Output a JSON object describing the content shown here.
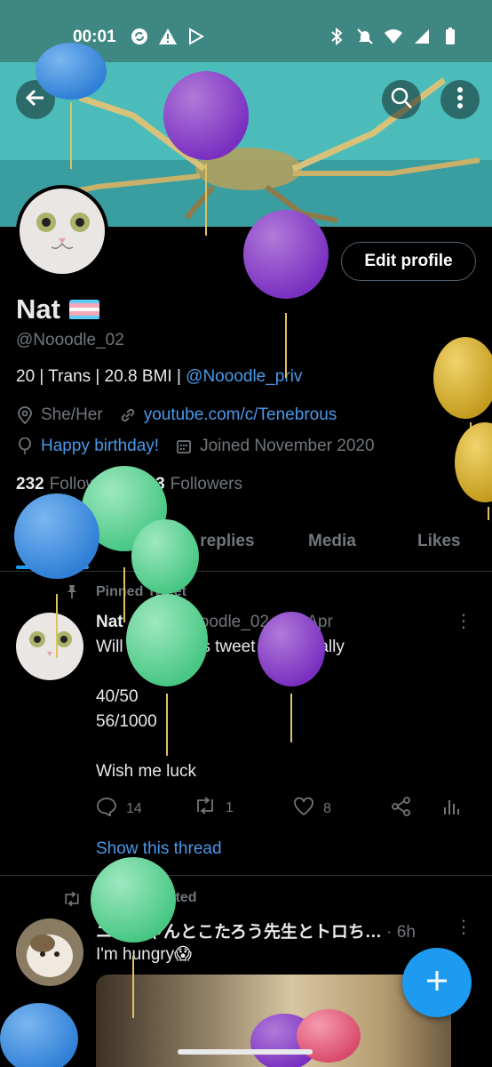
{
  "status_bar": {
    "time": "00:01"
  },
  "profile": {
    "name": "Nat",
    "handle": "@Nooodle_02",
    "bio_text": "20 | Trans | 20.8 BMI | ",
    "bio_link": "@Nooodle_priv",
    "pronouns": "She/Her",
    "website": "youtube.com/c/Tenebrous",
    "birthday": "Happy birthday!",
    "joined": "Joined November 2020",
    "following_count": "232",
    "following_label": "Following",
    "followers_count": "303",
    "followers_label": "Followers",
    "edit_button": "Edit profile"
  },
  "tabs": [
    "Tweets",
    "Tweets & replies",
    "Media",
    "Likes"
  ],
  "tweets": [
    {
      "context": "Pinned Tweet",
      "author": "Nat",
      "handle": "@Nooodle_02",
      "time": "· 21 Apr",
      "text": "Will update this tweet periodically\n\n40/50\n56/1000\n\nWish me luck",
      "replies": "14",
      "retweets": "1",
      "likes": "8",
      "show_thread": "Show this thread"
    },
    {
      "context": "You Retweeted",
      "author": "ニコちゃんとこたろう先生とトロち…",
      "time": "· 6h",
      "text": "I'm hungry😱"
    }
  ],
  "colors": {
    "status_bar": "#3f8782",
    "accent": "#1d9bf0",
    "link": "#4a99e9",
    "background": "#000000",
    "muted_text": "#71767b"
  },
  "icons": {
    "back": "arrow-left-icon",
    "search": "search-icon",
    "more": "more-vertical-icon",
    "location": "location-icon",
    "link": "link-icon",
    "birthday": "balloon-icon",
    "calendar": "calendar-icon",
    "pin": "pin-icon",
    "reply": "reply-icon",
    "retweet": "retweet-icon",
    "like": "heart-icon",
    "share": "share-icon",
    "analytics": "analytics-icon",
    "compose": "plus-icon"
  }
}
